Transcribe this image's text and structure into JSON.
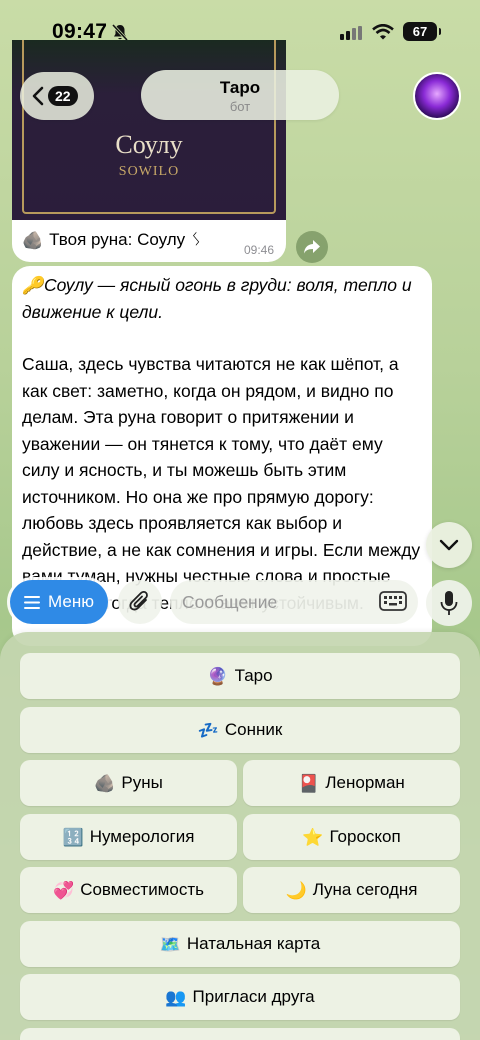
{
  "status_bar": {
    "time": "09:47",
    "battery": "67"
  },
  "header": {
    "back_count": "22",
    "title": "Таро",
    "subtitle": "бот"
  },
  "image_message": {
    "rune_name": "Соулу",
    "rune_latin": "SOWILO",
    "caption": "Твоя руна: Соулу ",
    "caption_icon": "ᛊ",
    "time": "09:46"
  },
  "text_message": {
    "line1": "Соулу — ясный огонь в груди: воля, тепло и движение к цели.",
    "paragraph": "Саша, здесь чувства читаются не как шёпот, а как свет: заметно, когда он рядом, и видно по делам. Эта руна говорит о притяжении и уважении — он тянется к тому, что даёт ему силу и ясность, и ты можешь быть этим источником. Но она же про прямую дорогу: любовь здесь проявляется как выбор и действие, а не как сомнения и игры. Если между вами туман, нужны честные слова и простые поступки, тогда тепло станет устойчивым."
  },
  "input_bar": {
    "menu_label": "Меню",
    "placeholder": "Сообщение"
  },
  "keyboard": {
    "taro": {
      "icon": "🔮",
      "label": "Таро"
    },
    "sonnik": {
      "icon": "💤",
      "label": "Сонник"
    },
    "runy": {
      "icon": "🪨",
      "label": "Руны"
    },
    "lenorman": {
      "icon": "🎴",
      "label": "Ленорман"
    },
    "numerologiya": {
      "icon": "🔢",
      "label": "Нумерология"
    },
    "goroskop": {
      "icon": "⭐",
      "label": "Гороскоп"
    },
    "sovmestimost": {
      "icon": "💞",
      "label": "Совместимость"
    },
    "luna": {
      "icon": "🌙",
      "label": "Луна сегодня"
    },
    "natalnaya": {
      "icon": "🗺️",
      "label": "Натальная карта"
    },
    "priglasi": {
      "icon": "👥",
      "label": "Пригласи друга"
    }
  }
}
